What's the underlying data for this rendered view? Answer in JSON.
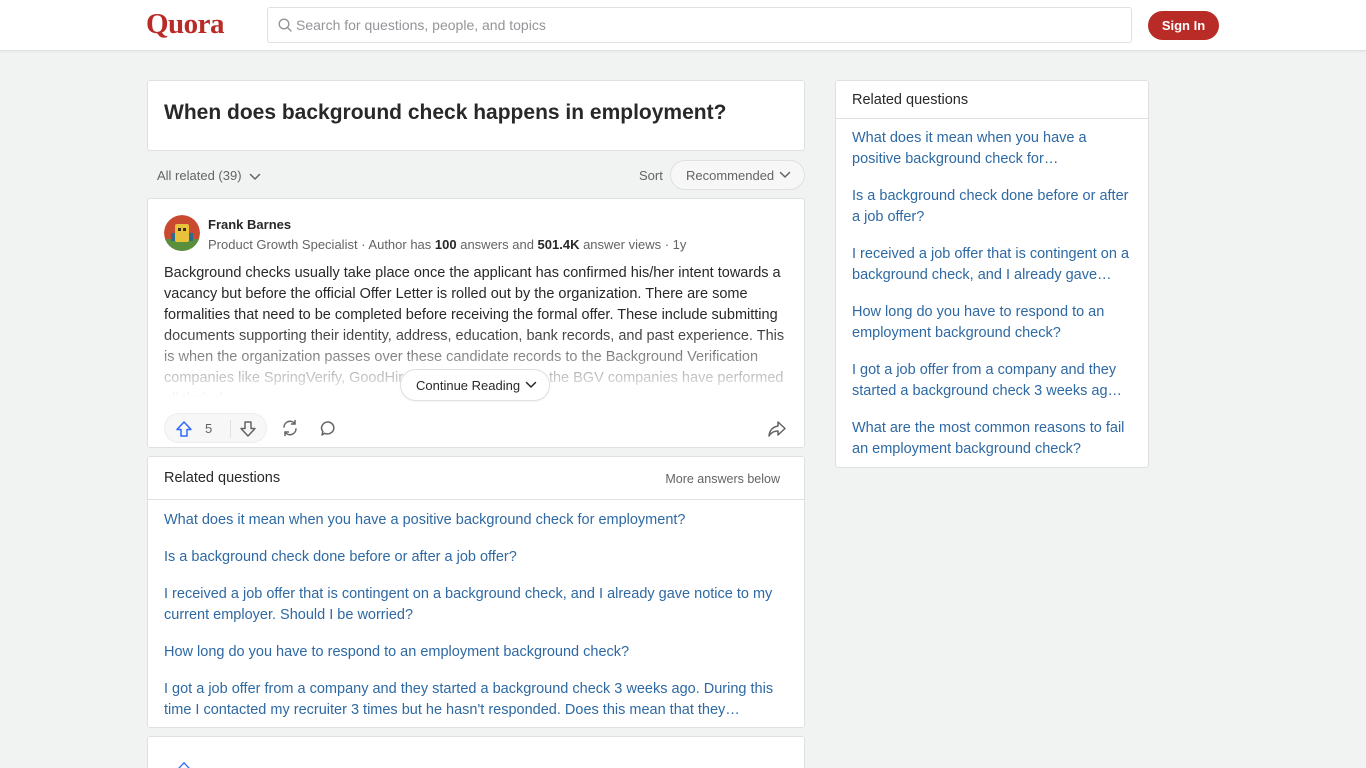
{
  "header": {
    "logo": "Quora",
    "search_placeholder": "Search for questions, people, and topics",
    "signin_label": "Sign In"
  },
  "question": {
    "title": "When does background check happens in employment?"
  },
  "filters": {
    "all_related": "All related (39)",
    "sort_label": "Sort",
    "sort_value": "Recommended"
  },
  "answer": {
    "author": "Frank Barnes",
    "credential": "Product Growth Specialist",
    "meta_mid": " · Author has ",
    "answers_count": "100",
    "meta_answers": " answers and ",
    "views_count": "501.4K",
    "meta_views": " answer views · 1y",
    "body": "Background checks usually take place once the applicant has confirmed his/her intent towards a vacancy but before the official Offer Letter is rolled out by the organization. There are some formalities that need to be completed before receiving the formal offer. These include submitting documents supporting their identity, address, education, bank records, and past experience. This is when the organization passes over these candidate records to the Background Verification companies like SpringVerify, GoodHire, HireRight, etc. After the BGV companies have performed all their due",
    "continue_label": "Continue Reading",
    "upvotes": "5"
  },
  "related_feed": {
    "title": "Related questions",
    "more": "More answers below",
    "items": [
      "What does it mean when you have a positive background check for employment?",
      "Is a background check done before or after a job offer?",
      "I received a job offer that is contingent on a background check, and I already gave notice to my current employer. Should I be worried?",
      "How long do you have to respond to an employment background check?",
      "I got a job offer from a company and they started a background check 3 weeks ago. During this time I contacted my recruiter 3 times but he hasn't responded. Does this mean that they…"
    ]
  },
  "sidebar": {
    "title": "Related questions",
    "items": [
      "What does it mean when you have a positive background check for…",
      "Is a background check done before or after a job offer?",
      "I received a job offer that is contingent on a background check, and I already gave…",
      "How long do you have to respond to an employment background check?",
      "I got a job offer from a company and they started a background check 3 weeks ag…",
      "What are the most common reasons to fail an employment background check?"
    ]
  },
  "colors": {
    "brand": "#b92b27",
    "link": "#2e69a3",
    "upvote": "#2e69ff"
  }
}
